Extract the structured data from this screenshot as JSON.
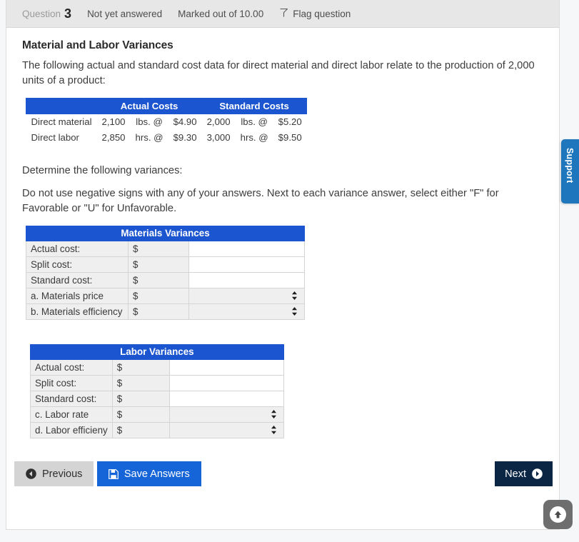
{
  "infobar": {
    "question_label": "Question",
    "question_number": "3",
    "answer_status": "Not yet answered",
    "marks": "Marked out of 10.00",
    "flag_label": "Flag question",
    "flag_icon": "flag-icon"
  },
  "question": {
    "title": "Material and Labor Variances",
    "intro": "The following actual and standard cost data for direct material and direct labor relate to the production of 2,000 units of a product:",
    "determine": "Determine the following variances:",
    "instructions": "Do not use negative signs with any of your answers. Next to each variance answer, select either \"F\" for Favorable or \"U\" for Unfavorable."
  },
  "cost_table": {
    "group_headers": [
      "",
      "Actual Costs",
      "Standard Costs"
    ],
    "rows": [
      {
        "label": "Direct material",
        "actual_qty": "2,100",
        "actual_unit": "lbs. @",
        "actual_rate": "$4.90",
        "standard_qty": "2,000",
        "standard_unit": "lbs. @",
        "standard_rate": "$5.20"
      },
      {
        "label": "Direct labor",
        "actual_qty": "2,850",
        "actual_unit": "hrs. @",
        "actual_rate": "$9.30",
        "standard_qty": "3,000",
        "standard_unit": "hrs. @",
        "standard_rate": "$9.50"
      }
    ]
  },
  "materials_variances": {
    "header": "Materials Variances",
    "rows": [
      {
        "label": "Actual cost:",
        "currency": "$",
        "value": "",
        "type": "input"
      },
      {
        "label": "Split cost:",
        "currency": "$",
        "value": "",
        "type": "input"
      },
      {
        "label": "Standard cost:",
        "currency": "$",
        "value": "",
        "type": "input"
      },
      {
        "label": "a. Materials price",
        "currency": "$",
        "value": "",
        "type": "select",
        "selected": ""
      },
      {
        "label": "b. Materials efficiency",
        "currency": "$",
        "value": "",
        "type": "select",
        "selected": ""
      }
    ]
  },
  "labor_variances": {
    "header": "Labor Variances",
    "rows": [
      {
        "label": "Actual cost:",
        "currency": "$",
        "value": "",
        "type": "input"
      },
      {
        "label": "Split cost:",
        "currency": "$",
        "value": "",
        "type": "input"
      },
      {
        "label": "Standard cost:",
        "currency": "$",
        "value": "",
        "type": "input"
      },
      {
        "label": "c. Labor rate",
        "currency": "$",
        "value": "",
        "type": "select",
        "selected": ""
      },
      {
        "label": "d. Labor efficieny",
        "currency": "$",
        "value": "",
        "type": "select",
        "selected": ""
      }
    ]
  },
  "nav": {
    "previous_label": "Previous",
    "save_label": "Save Answers",
    "next_label": "Next"
  },
  "support_tab": {
    "label": "Support"
  },
  "scroll_top": {
    "icon": "arrow-up-icon"
  },
  "colors": {
    "table_header_blue": "#1b55cf",
    "save_button_blue": "#1565d8",
    "next_button_navy": "#0b2545",
    "support_blue": "#1e76bc",
    "row_gray": "#efefef"
  }
}
